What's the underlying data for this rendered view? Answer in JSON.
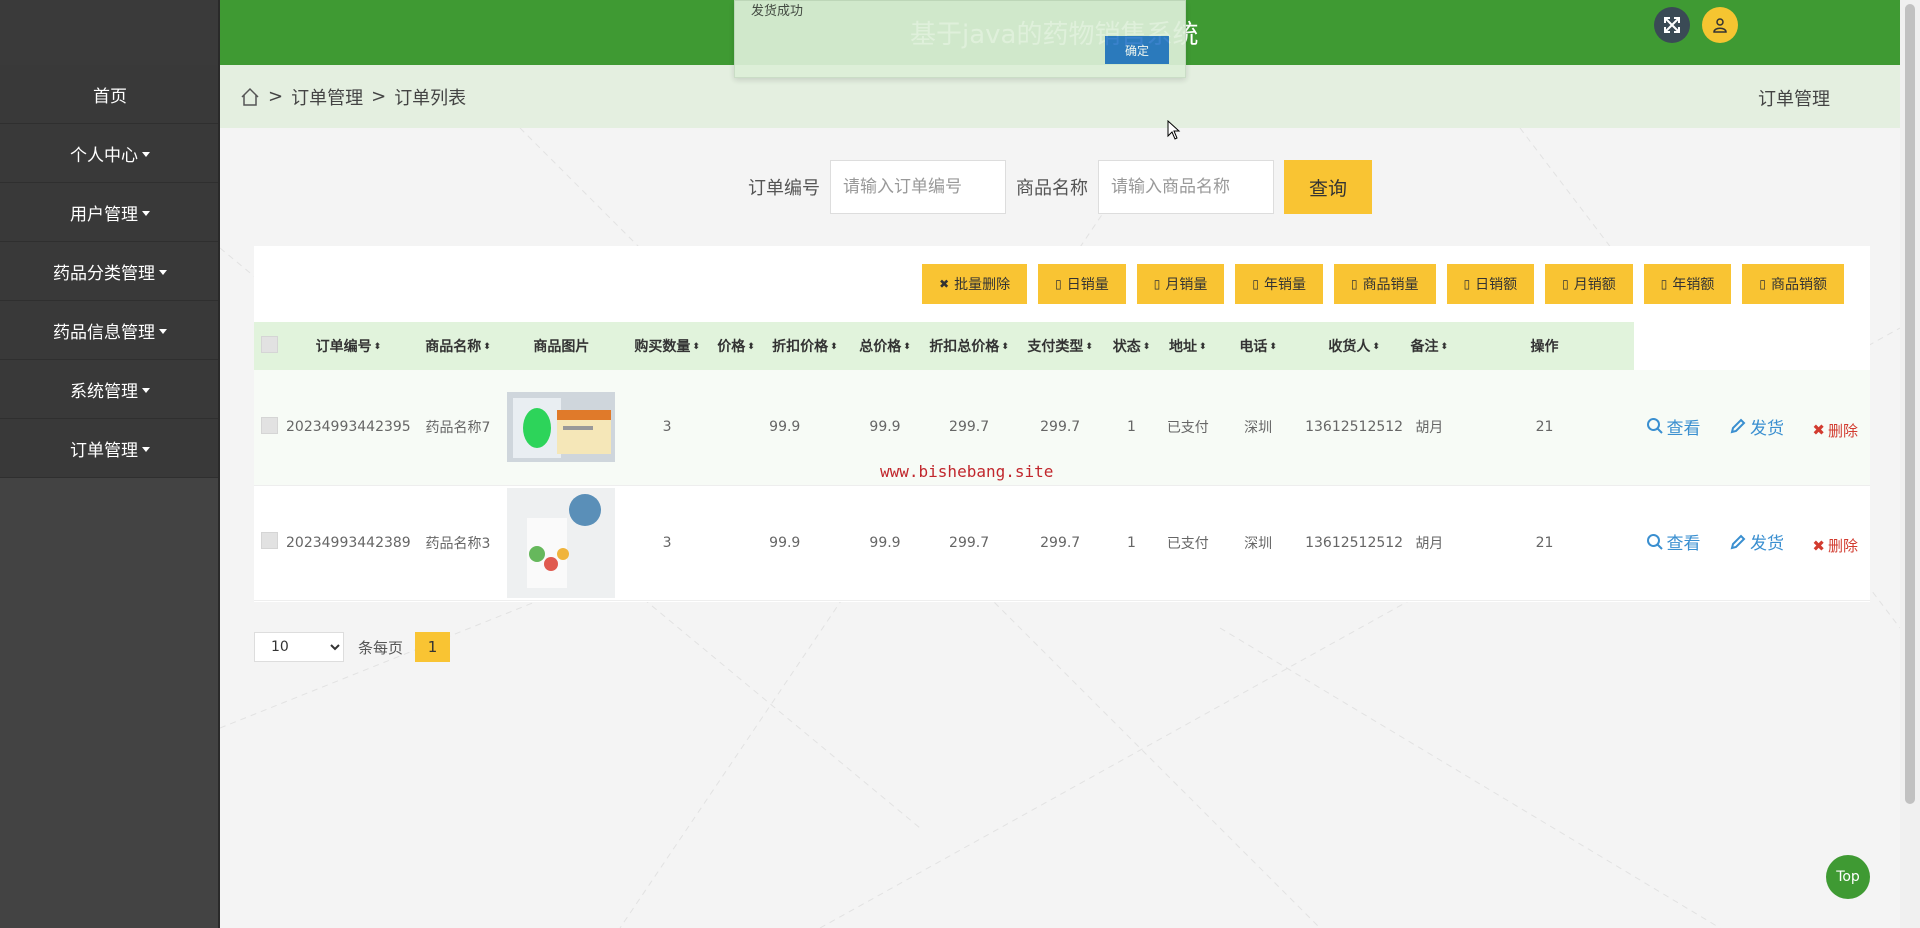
{
  "app": {
    "title": "基于java的药物销售系统"
  },
  "sidebar": {
    "items": [
      {
        "label": "首页",
        "has_caret": false
      },
      {
        "label": "个人中心",
        "has_caret": true
      },
      {
        "label": "用户管理",
        "has_caret": true
      },
      {
        "label": "药品分类管理",
        "has_caret": true
      },
      {
        "label": "药品信息管理",
        "has_caret": true
      },
      {
        "label": "系统管理",
        "has_caret": true
      },
      {
        "label": "订单管理",
        "has_caret": true
      }
    ]
  },
  "breadcrumb": {
    "sep": ">",
    "level1": "订单管理",
    "level2": "订单列表",
    "right": "订单管理"
  },
  "search": {
    "order_label": "订单编号",
    "order_placeholder": "请输入订单编号",
    "goods_label": "商品名称",
    "goods_placeholder": "请输入商品名称",
    "button": "查询"
  },
  "actions": [
    "批量删除",
    "日销量",
    "月销量",
    "年销量",
    "商品销量",
    "日销额",
    "月销额",
    "年销额",
    "商品销额"
  ],
  "table": {
    "columns": [
      "订单编号",
      "商品名称",
      "商品图片",
      "购买数量",
      "价格",
      "折扣价格",
      "总价格",
      "折扣总价格",
      "支付类型",
      "状态",
      "地址",
      "电话",
      "收货人",
      "备注",
      "操作"
    ],
    "rows": [
      {
        "order_no": "20234993442395",
        "goods": "药品名称7",
        "qty": "3",
        "price": "99.9",
        "discount_price": "99.9",
        "total": "299.7",
        "discount_total": "299.7",
        "pay_type": "1",
        "status": "已支付",
        "address": "深圳",
        "phone": "13612512512",
        "receiver": "胡月",
        "remark": "21"
      },
      {
        "order_no": "20234993442389",
        "goods": "药品名称3",
        "qty": "3",
        "price": "99.9",
        "discount_price": "99.9",
        "total": "299.7",
        "discount_total": "299.7",
        "pay_type": "1",
        "status": "已支付",
        "address": "深圳",
        "phone": "13612512512",
        "receiver": "胡月",
        "remark": "21"
      }
    ],
    "op_view": "查看",
    "op_ship": "发货",
    "op_delete": "删除"
  },
  "watermark": "www.bishebang.site",
  "pager": {
    "size": "10",
    "per_page_label": "条每页",
    "current": "1"
  },
  "toast": {
    "message": "发货成功",
    "ok": "确定"
  },
  "top_button": "Top",
  "colors": {
    "header": "#3f9a33",
    "accent": "#f9c433",
    "sidebar": "#393939"
  }
}
